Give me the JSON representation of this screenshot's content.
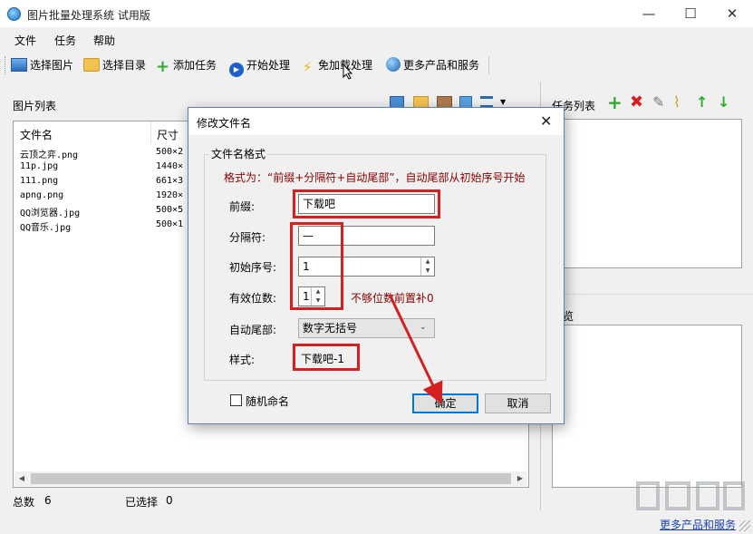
{
  "window": {
    "title": "图片批量处理系统 试用版",
    "min_glyph": "—",
    "max_glyph": "☐",
    "close_glyph": "✕"
  },
  "menu": [
    "文件",
    "任务",
    "帮助"
  ],
  "toolbar": {
    "select_image": "选择图片",
    "select_dir": "选择目录",
    "add_task": "添加任务",
    "start": "开始处理",
    "free_install": "免加载处理",
    "more_products": "更多产品和服务"
  },
  "image_list": {
    "label": "图片列表",
    "columns": [
      "文件名",
      "尺寸"
    ],
    "rows": [
      {
        "name": "云顶之弈.png",
        "size": "500×2"
      },
      {
        "name": "11p.jpg",
        "size": "1440×"
      },
      {
        "name": "111.png",
        "size": "661×3"
      },
      {
        "name": "apng.png",
        "size": "1920×"
      },
      {
        "name": "QQ浏览器.jpg",
        "size": "500×5"
      },
      {
        "name": "QQ音乐.jpg",
        "size": "500×1"
      }
    ]
  },
  "task_list": {
    "label": "任务列表"
  },
  "preview": {
    "label_partial": "览"
  },
  "status": {
    "total_label": "总数",
    "total_value": "6",
    "selected_label": "已选择",
    "selected_value": "0"
  },
  "footer_link": "更多产品和服务",
  "dialog": {
    "title": "修改文件名",
    "group_title": "文件名格式",
    "hint": "格式为：“前缀+分隔符+自动尾部”，自动尾部从初始序号开始",
    "prefix_label": "前缀:",
    "prefix_value": "下载吧",
    "separator_label": "分隔符:",
    "separator_value": "—",
    "start_label": "初始序号:",
    "start_value": "1",
    "digits_label": "有效位数:",
    "digits_value": "1",
    "digits_note": "不够位数前置补0",
    "auto_tail_label": "自动尾部:",
    "auto_tail_value": "数字无括号",
    "style_label": "样式:",
    "style_value": "下载吧-1",
    "random_label": "随机命名",
    "ok": "确定",
    "cancel": "取消"
  },
  "colors": {
    "annotation_red": "#d42020",
    "hint_red": "#8b0000",
    "ok_border": "#0078d7"
  }
}
